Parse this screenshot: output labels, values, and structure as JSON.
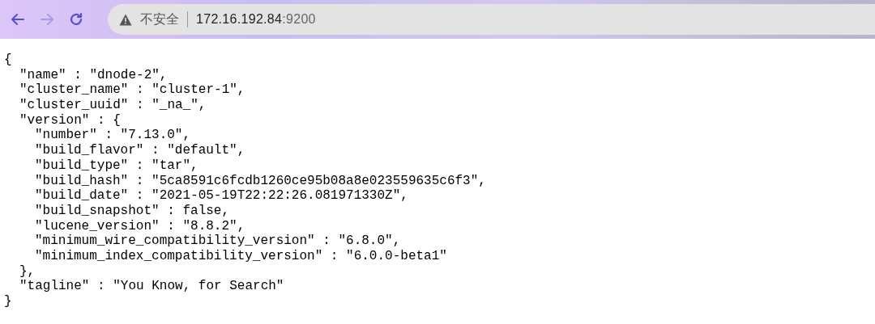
{
  "toolbar": {
    "nav": [
      {
        "kind": "back",
        "disabled": false
      },
      {
        "kind": "forward",
        "disabled": true
      },
      {
        "kind": "reload",
        "disabled": false
      }
    ],
    "address": {
      "security": "不安全",
      "host": "172.16.192.84",
      "port": ":9200"
    }
  },
  "document": {
    "open": "{",
    "close": "}",
    "children": [
      {
        "text": "\"name\" : \"dnode-2\","
      },
      {
        "text": "\"cluster_name\" : \"cluster-1\","
      },
      {
        "text": "\"cluster_uuid\" : \"_na_\","
      },
      {
        "text": "\"version\" : {",
        "close": "},",
        "children": [
          {
            "text": "\"number\" : \"7.13.0\","
          },
          {
            "text": "\"build_flavor\" : \"default\","
          },
          {
            "text": "\"build_type\" : \"tar\","
          },
          {
            "text": "\"build_hash\" : \"5ca8591c6fcdb1260ce95b08a8e023559635c6f3\","
          },
          {
            "text": "\"build_date\" : \"2021-05-19T22:22:26.081971330Z\","
          },
          {
            "text": "\"build_snapshot\" : false,"
          },
          {
            "text": "\"lucene_version\" : \"8.8.2\","
          },
          {
            "text": "\"minimum_wire_compatibility_version\" : \"6.8.0\","
          },
          {
            "text": "\"minimum_index_compatibility_version\" : \"6.0.0-beta1\""
          }
        ]
      },
      {
        "text": "\"tagline\" : \"You Know, for Search\""
      }
    ]
  }
}
